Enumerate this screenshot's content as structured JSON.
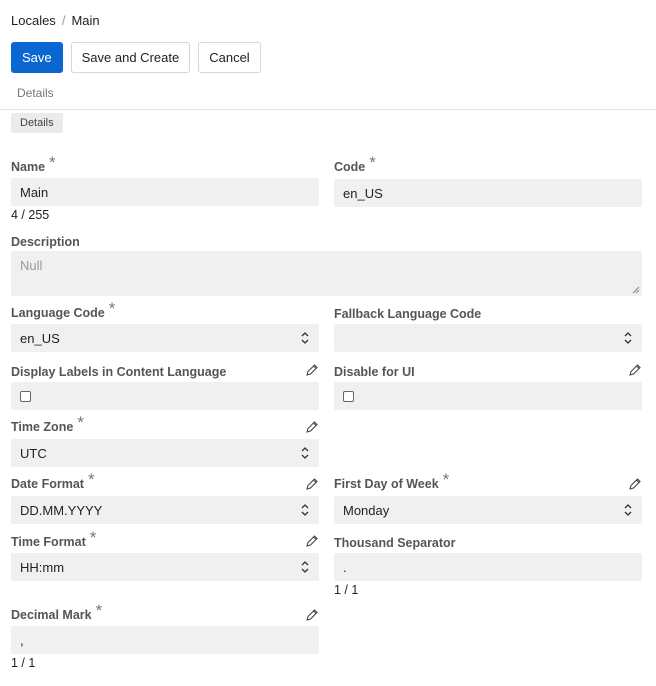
{
  "breadcrumb": {
    "parent": "Locales",
    "separator": "/",
    "current": "Main"
  },
  "toolbar": {
    "save_label": "Save",
    "save_create_label": "Save and Create",
    "cancel_label": "Cancel"
  },
  "tabs": {
    "details": "Details"
  },
  "section": {
    "details": "Details"
  },
  "fields": {
    "name": {
      "label": "Name",
      "value": "Main",
      "counter": "4 / 255"
    },
    "code": {
      "label": "Code",
      "value": "en_US"
    },
    "description": {
      "label": "Description",
      "placeholder": "Null"
    },
    "language_code": {
      "label": "Language Code",
      "value": "en_US"
    },
    "fallback_language_code": {
      "label": "Fallback Language Code",
      "value": ""
    },
    "display_labels": {
      "label": "Display Labels in Content Language"
    },
    "disable_for_ui": {
      "label": "Disable for UI"
    },
    "time_zone": {
      "label": "Time Zone",
      "value": "UTC"
    },
    "date_format": {
      "label": "Date Format",
      "value": "DD.MM.YYYY"
    },
    "first_day_of_week": {
      "label": "First Day of Week",
      "value": "Monday"
    },
    "time_format": {
      "label": "Time Format",
      "value": "HH:mm"
    },
    "thousand_separator": {
      "label": "Thousand Separator",
      "value": ".",
      "counter": "1 / 1"
    },
    "decimal_mark": {
      "label": "Decimal Mark",
      "value": ",",
      "counter": "1 / 1"
    }
  },
  "required_marker": "*",
  "colors": {
    "primary": "#0a66d1",
    "field_bg": "#f0f0f0",
    "chip_bg": "#ebebeb"
  }
}
